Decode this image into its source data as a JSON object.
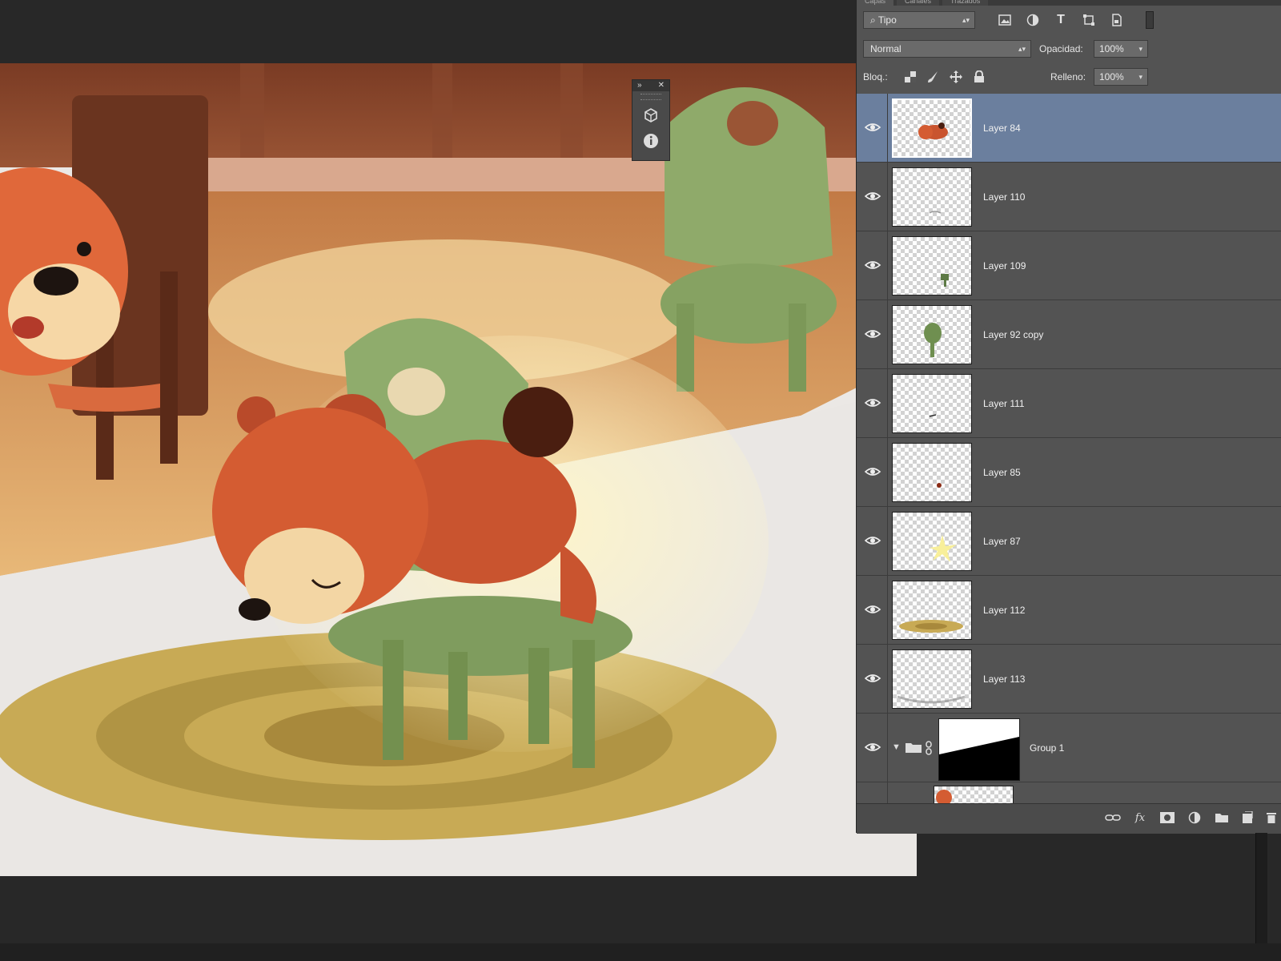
{
  "panel": {
    "tabs": [
      "Capas",
      "Canales",
      "Trazados"
    ],
    "filter": {
      "label": "Tipo",
      "icon": "search-icon"
    },
    "blend_mode": "Normal",
    "opacity_label": "Opacidad:",
    "opacity_value": "100%",
    "lock_label": "Bloq.:",
    "fill_label": "Relleno:",
    "fill_value": "100%"
  },
  "layers": [
    {
      "name": "Layer 84",
      "selected": true,
      "visible": true
    },
    {
      "name": "Layer 110",
      "selected": false,
      "visible": true
    },
    {
      "name": "Layer 109",
      "selected": false,
      "visible": true
    },
    {
      "name": "Layer 92 copy",
      "selected": false,
      "visible": true
    },
    {
      "name": "Layer 111",
      "selected": false,
      "visible": true
    },
    {
      "name": "Layer 85",
      "selected": false,
      "visible": true
    },
    {
      "name": "Layer 87",
      "selected": false,
      "visible": true
    },
    {
      "name": "Layer 112",
      "selected": false,
      "visible": true
    },
    {
      "name": "Layer 113",
      "selected": false,
      "visible": true
    },
    {
      "name": "Group 1",
      "selected": false,
      "visible": true,
      "is_group": true,
      "expanded": true
    }
  ],
  "footer_icons": [
    "link-icon",
    "fx-icon",
    "layer-mask-icon",
    "adjustment-layer-icon",
    "new-group-icon",
    "new-layer-icon",
    "trash-icon"
  ],
  "mini_panel_icons": [
    "3d-icon",
    "info-icon"
  ],
  "colors": {
    "selection": "#6b7f9e",
    "panel": "#535353",
    "workspace": "#282828"
  }
}
